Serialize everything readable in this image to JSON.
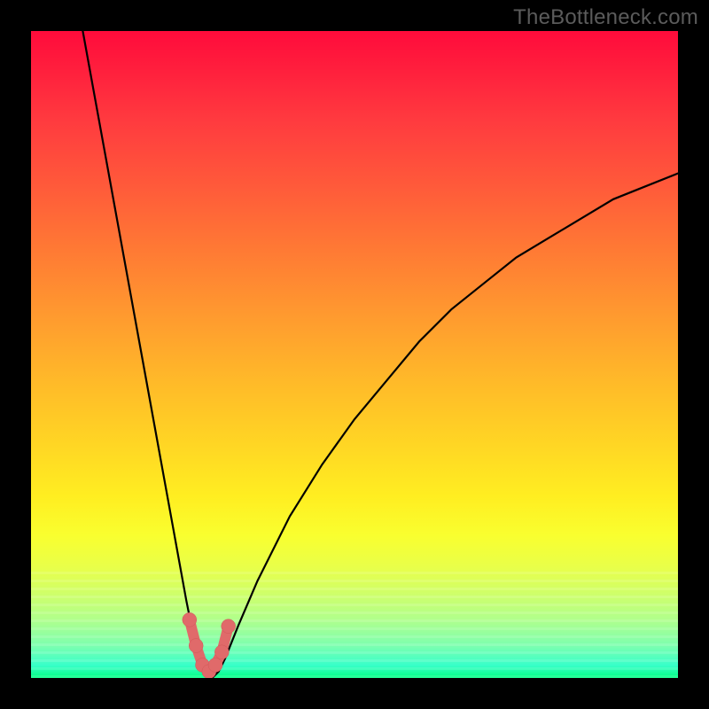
{
  "watermark": "TheBottleneck.com",
  "chart_data": {
    "type": "line",
    "title": "",
    "xlabel": "",
    "ylabel": "",
    "xlim": [
      0,
      100
    ],
    "ylim": [
      0,
      100
    ],
    "grid": false,
    "legend": null,
    "series": [
      {
        "name": "bottleneck-curve",
        "x": [
          8,
          10,
          12,
          14,
          16,
          18,
          20,
          22,
          24,
          25,
          26,
          27,
          28,
          29,
          30,
          32,
          35,
          40,
          45,
          50,
          55,
          60,
          65,
          70,
          75,
          80,
          85,
          90,
          95,
          100
        ],
        "y": [
          100,
          89,
          78,
          67,
          56,
          45,
          34,
          23,
          12,
          7,
          3,
          1,
          0,
          1,
          3,
          8,
          15,
          25,
          33,
          40,
          46,
          52,
          57,
          61,
          65,
          68,
          71,
          74,
          76,
          78
        ]
      }
    ],
    "highlight_points": {
      "name": "optimal-region",
      "x": [
        24.5,
        25.5,
        26.5,
        27.5,
        28.5,
        29.5,
        30.5
      ],
      "y": [
        9,
        5,
        2,
        1,
        2,
        4,
        8
      ]
    },
    "colors": {
      "curve": "#000000",
      "highlight": "#e06a6a",
      "gradient_top": "#ff0b3b",
      "gradient_bottom": "#00ff83"
    }
  }
}
